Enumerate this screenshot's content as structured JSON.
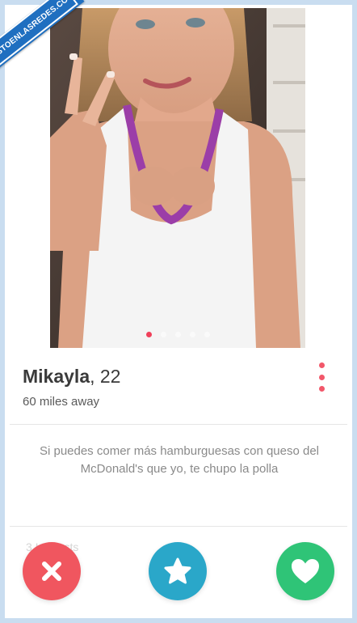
{
  "watermark": {
    "text": "VISTOENLASREDES.COM"
  },
  "profile": {
    "name": "Mikayla",
    "age": "22",
    "distance": "60 miles away",
    "photo_count": 5,
    "active_photo": 1
  },
  "bio": {
    "text": "Si puedes comer más hamburguesas con queso del McDonald's que yo, te chupo la polla"
  },
  "interests": {
    "label": "3 Interests"
  },
  "actions": {
    "nope": {
      "icon": "close-icon",
      "color": "#f0565f"
    },
    "super_like": {
      "icon": "star-icon",
      "color": "#2aa7c9"
    },
    "like": {
      "icon": "heart-icon",
      "color": "#2fc477"
    }
  },
  "colors": {
    "accent": "#f0405a",
    "frame": "#c9ddf0"
  }
}
